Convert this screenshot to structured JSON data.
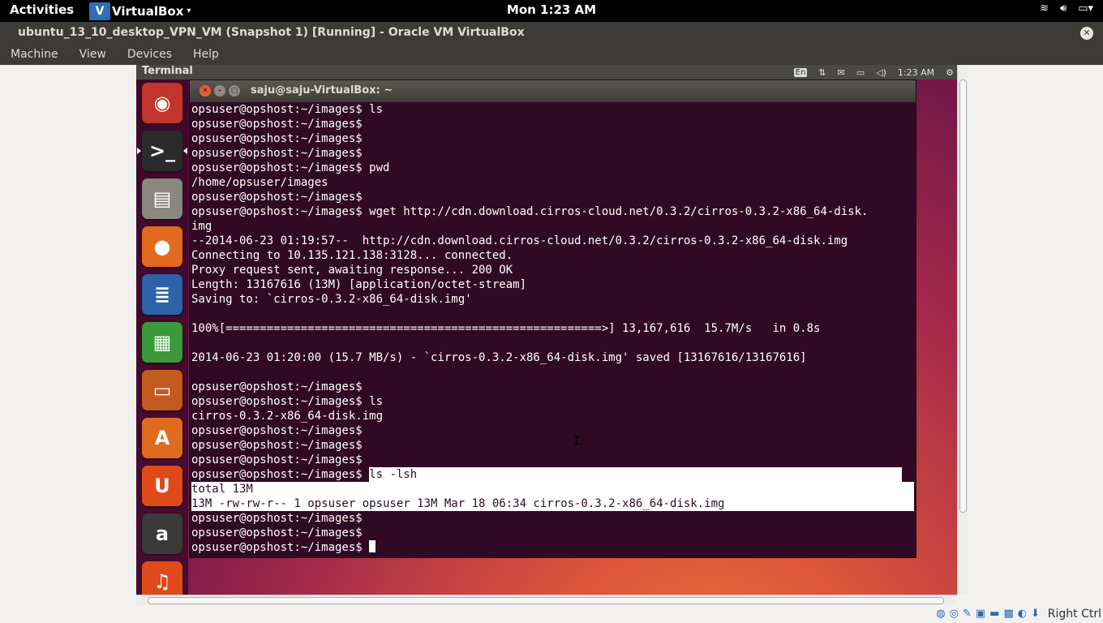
{
  "top_bar": {
    "activities": "Activities",
    "app_name": "VirtualBox",
    "app_menu_arrow": "▾",
    "clock": "Mon  1:23 AM",
    "tray_icons": [
      "wifi-icon",
      "volume-icon",
      "battery-icon",
      "settings-icon"
    ]
  },
  "vbox_window": {
    "title": "ubuntu_13_10_desktop_VPN_VM (Snapshot 1) [Running] - Oracle VM VirtualBox",
    "menu": [
      "Machine",
      "View",
      "Devices",
      "Help"
    ]
  },
  "guest": {
    "panel_title": "Terminal",
    "keyboard_layout": "En",
    "time": "1:23 AM",
    "launcher": [
      {
        "name": "dash-home",
        "glyph": "◉",
        "color": "#c2352b"
      },
      {
        "name": "terminal",
        "glyph": ">_",
        "color": "#2b2b2b",
        "active": true
      },
      {
        "name": "files",
        "glyph": "▤",
        "color": "#8a8680"
      },
      {
        "name": "firefox",
        "glyph": "●",
        "color": "#e2691e"
      },
      {
        "name": "libreoffice-writer",
        "glyph": "≣",
        "color": "#2d62a8"
      },
      {
        "name": "libreoffice-calc",
        "glyph": "▦",
        "color": "#3a9a3a"
      },
      {
        "name": "libreoffice-impress",
        "glyph": "▭",
        "color": "#c45a1e"
      },
      {
        "name": "software-center",
        "glyph": "A",
        "color": "#e06b1e"
      },
      {
        "name": "ubuntu-one",
        "glyph": "U",
        "color": "#e04a1a"
      },
      {
        "name": "amazon",
        "glyph": "a",
        "color": "#3a3a3a"
      },
      {
        "name": "ubuntu-one-music",
        "glyph": "♫",
        "color": "#e04a1a"
      }
    ]
  },
  "terminal": {
    "title": "saju@saju-VirtualBox: ~",
    "prompt": "opsuser@opshost:~/images$ ",
    "lines": [
      "opsuser@opshost:~/images$ ls",
      "opsuser@opshost:~/images$",
      "opsuser@opshost:~/images$",
      "opsuser@opshost:~/images$",
      "opsuser@opshost:~/images$ pwd",
      "/home/opsuser/images",
      "opsuser@opshost:~/images$",
      "opsuser@opshost:~/images$ wget http://cdn.download.cirros-cloud.net/0.3.2/cirros-0.3.2-x86_64-disk.",
      "img",
      "--2014-06-23 01:19:57--  http://cdn.download.cirros-cloud.net/0.3.2/cirros-0.3.2-x86_64-disk.img",
      "Connecting to 10.135.121.138:3128... connected.",
      "Proxy request sent, awaiting response... 200 OK",
      "Length: 13167616 (13M) [application/octet-stream]",
      "Saving to: `cirros-0.3.2-x86_64-disk.img'",
      "",
      "100%[=======================================================>] 13,167,616  15.7M/s   in 0.8s",
      "",
      "2014-06-23 01:20:00 (15.7 MB/s) - `cirros-0.3.2-x86_64-disk.img' saved [13167616/13167616]",
      "",
      "opsuser@opshost:~/images$",
      "opsuser@opshost:~/images$ ls",
      "cirros-0.3.2-x86_64-disk.img",
      "opsuser@opshost:~/images$",
      "opsuser@opshost:~/images$",
      "opsuser@opshost:~/images$"
    ],
    "selected_command": "ls -lsh",
    "selected_output": [
      "total 13M",
      "13M -rw-rw-r-- 1 opsuser opsuser 13M Mar 18 06:34 cirros-0.3.2-x86_64-disk.img"
    ],
    "trailing_lines": [
      "opsuser@opshost:~/images$",
      "opsuser@opshost:~/images$"
    ],
    "last_prompt": "opsuser@opshost:~/images$ "
  },
  "status_bar": {
    "host_key": "Right Ctrl",
    "icons": [
      "hard-disk-icon",
      "optical-drive-icon",
      "usb-icon",
      "network-icon",
      "shared-folder-icon",
      "display-icon",
      "capture-icon",
      "mouse-integration-icon"
    ]
  }
}
